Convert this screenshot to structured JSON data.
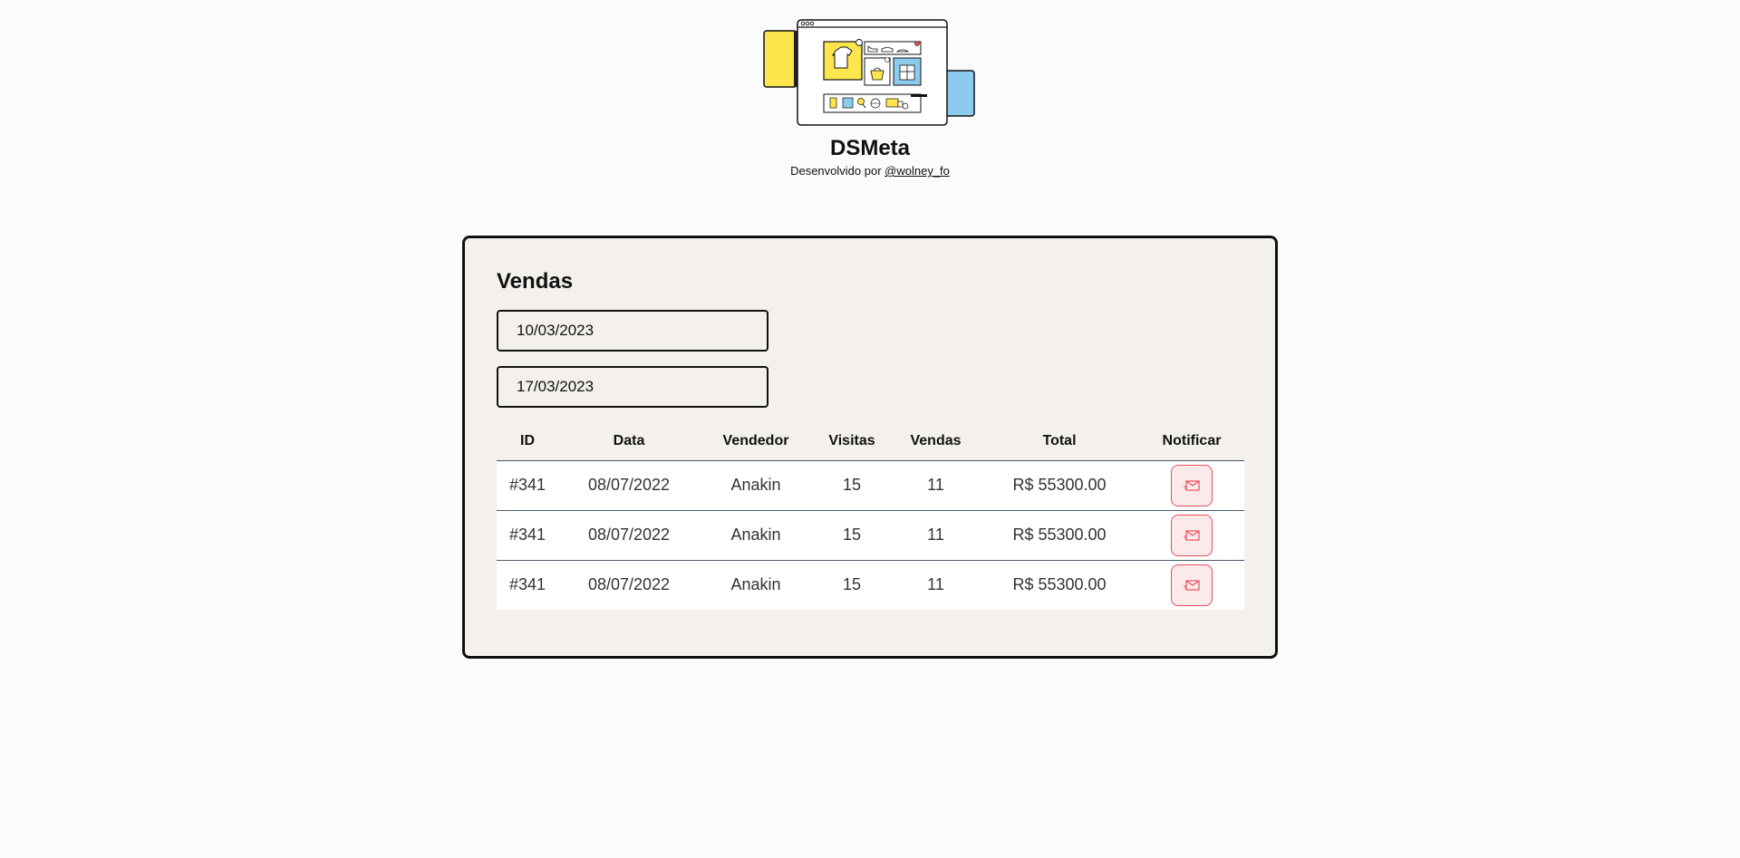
{
  "header": {
    "title": "DSMeta",
    "subtitle_prefix": "Desenvolvido por",
    "author_link": "@wolney_fo"
  },
  "sales": {
    "title": "Vendas",
    "min_date": "10/03/2023",
    "max_date": "17/03/2023",
    "columns": [
      "ID",
      "Data",
      "Vendedor",
      "Visitas",
      "Vendas",
      "Total",
      "Notificar"
    ],
    "rows": [
      {
        "id": "#341",
        "date": "08/07/2022",
        "seller": "Anakin",
        "visits": "15",
        "sales": "11",
        "total": "R$ 55300.00"
      },
      {
        "id": "#341",
        "date": "08/07/2022",
        "seller": "Anakin",
        "visits": "15",
        "sales": "11",
        "total": "R$ 55300.00"
      },
      {
        "id": "#341",
        "date": "08/07/2022",
        "seller": "Anakin",
        "visits": "15",
        "sales": "11",
        "total": "R$ 55300.00"
      }
    ]
  },
  "colors": {
    "accent_red": "#e84d5a",
    "card_bg": "#f4f1ec",
    "logo_yellow": "#fde54d",
    "logo_blue": "#8ccbee"
  },
  "icons": {
    "logo": "shop-illustration-icon",
    "notify": "envelope-icon"
  }
}
